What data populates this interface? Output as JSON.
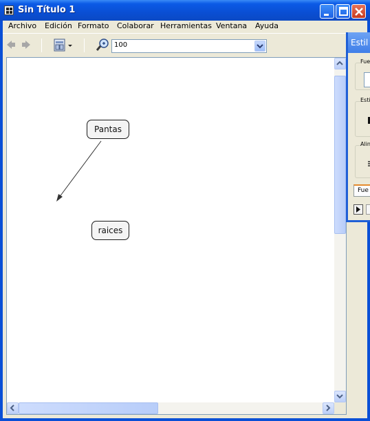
{
  "window": {
    "title": "Sin Título 1",
    "accent": "#0a4fd6"
  },
  "menu": {
    "items": [
      "Archivo",
      "Edición",
      "Formato",
      "Colaborar",
      "Herramientas",
      "Ventana",
      "Ayuda"
    ]
  },
  "toolbar": {
    "back_icon": "back-arrow-icon",
    "forward_icon": "forward-arrow-icon",
    "view_icon": "map-view-icon",
    "zoom_icon": "zoom-icon",
    "zoom_value": "100"
  },
  "canvas": {
    "concepts": [
      {
        "label": "Pantas"
      },
      {
        "label": "raices"
      }
    ]
  },
  "style_panel": {
    "title": "Estil",
    "groups": [
      "Fue",
      "Esti",
      "Aline"
    ],
    "tab": "Fue"
  }
}
